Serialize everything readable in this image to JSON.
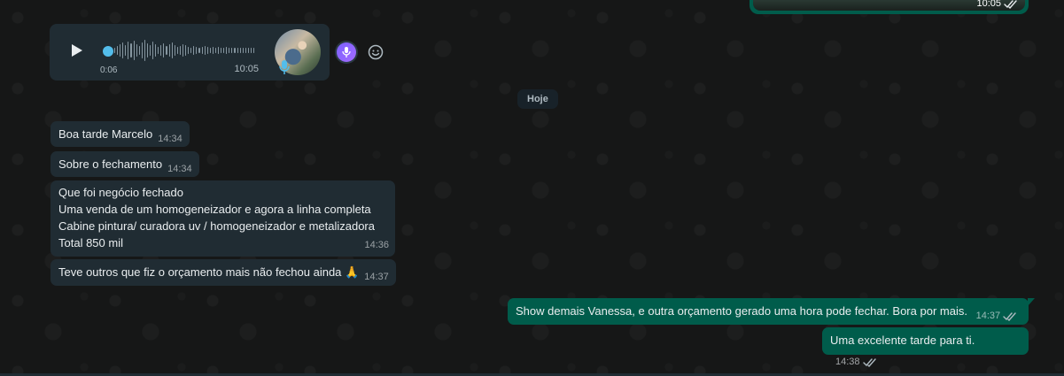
{
  "top_media": {
    "time": "10:05",
    "status": "read"
  },
  "audio": {
    "duration": "0:06",
    "time": "10:05",
    "play_icon": "play-icon",
    "transcribe_icon": "transcribe-icon",
    "emoji_icon": "emoji-icon"
  },
  "date_chip": "Hoje",
  "incoming": [
    {
      "lines": [
        "Boa tarde Marcelo"
      ],
      "time": "14:34"
    },
    {
      "lines": [
        "Sobre o fechamento"
      ],
      "time": "14:34"
    },
    {
      "lines": [
        "Que foi negócio fechado",
        "Uma venda de um homogeneizador e agora a linha completa",
        "Cabine pintura/ curadora uv / homogeneizador e metalizadora",
        "Total 850 mil"
      ],
      "time": "14:36"
    },
    {
      "lines": [
        "Teve outros que fiz o orçamento mais não fechou ainda 🙏"
      ],
      "time": "14:37"
    }
  ],
  "outgoing": [
    {
      "text": "Show demais Vanessa, e outra orçamento gerado uma hora pode fechar. Bora por mais.",
      "time": "14:37",
      "status": "read"
    },
    {
      "text": "Uma excelente tarde para ti.",
      "time": "14:38",
      "status": "read"
    }
  ],
  "colors": {
    "incoming_bubble": "#202c33",
    "outgoing_bubble": "#005c4b",
    "accent_blue": "#53bdeb",
    "text_primary": "#e9edef"
  }
}
